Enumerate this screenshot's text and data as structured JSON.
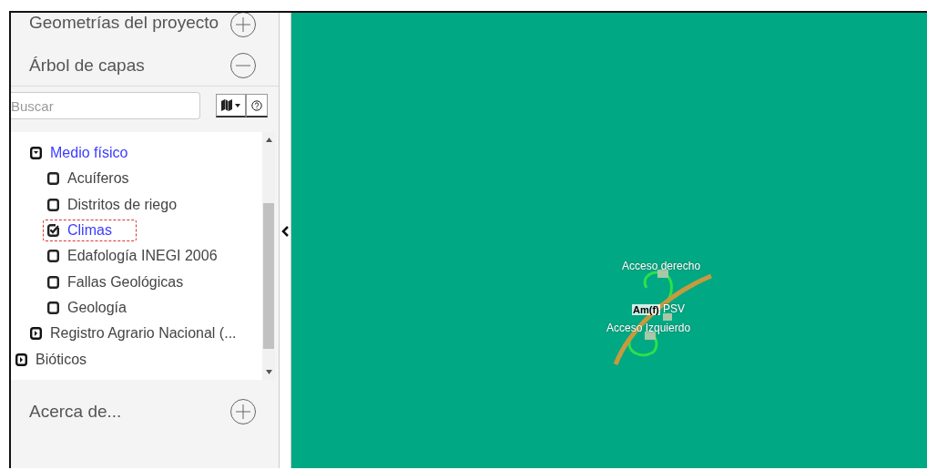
{
  "sidebar": {
    "sections": [
      {
        "title": "Geometrías del proyecto",
        "expanded": false
      },
      {
        "title": "Árbol de capas",
        "expanded": true
      }
    ],
    "search": {
      "placeholder": "Buscar"
    },
    "tree": [
      {
        "children": [
          {
            "label": "Medio físico",
            "kind": "folder",
            "expanded": true,
            "highlighted": true,
            "children": [
              {
                "label": "Acuíferos",
                "kind": "layer",
                "checked": false,
                "highlighted": false,
                "selected": false
              },
              {
                "label": "Distritos de riego",
                "kind": "layer",
                "checked": false,
                "highlighted": false,
                "selected": false
              },
              {
                "label": "Climas",
                "kind": "layer",
                "checked": true,
                "highlighted": true,
                "selected": true
              },
              {
                "label": "Edafología INEGI 2006",
                "kind": "layer",
                "checked": false,
                "highlighted": false,
                "selected": false
              },
              {
                "label": "Fallas Geológicas",
                "kind": "layer",
                "checked": false,
                "highlighted": false,
                "selected": false
              },
              {
                "label": "Geología",
                "kind": "layer",
                "checked": false,
                "highlighted": false,
                "selected": false
              }
            ]
          },
          {
            "label": "Registro Agrario Nacional (...",
            "kind": "folder",
            "expanded": false,
            "highlighted": false
          }
        ]
      },
      {
        "label": "Bióticos",
        "kind": "folder",
        "expanded": false,
        "highlighted": false
      }
    ],
    "footer": {
      "title": "Acerca de...",
      "expanded": false
    }
  },
  "map": {
    "labels": [
      {
        "text": "Acceso derecho",
        "kind": "plain"
      },
      {
        "text": "Am(f)",
        "kind": "halo"
      },
      {
        "text": "PSV",
        "kind": "plain"
      },
      {
        "text": "Acceso Izquierdo",
        "kind": "plain"
      }
    ]
  }
}
